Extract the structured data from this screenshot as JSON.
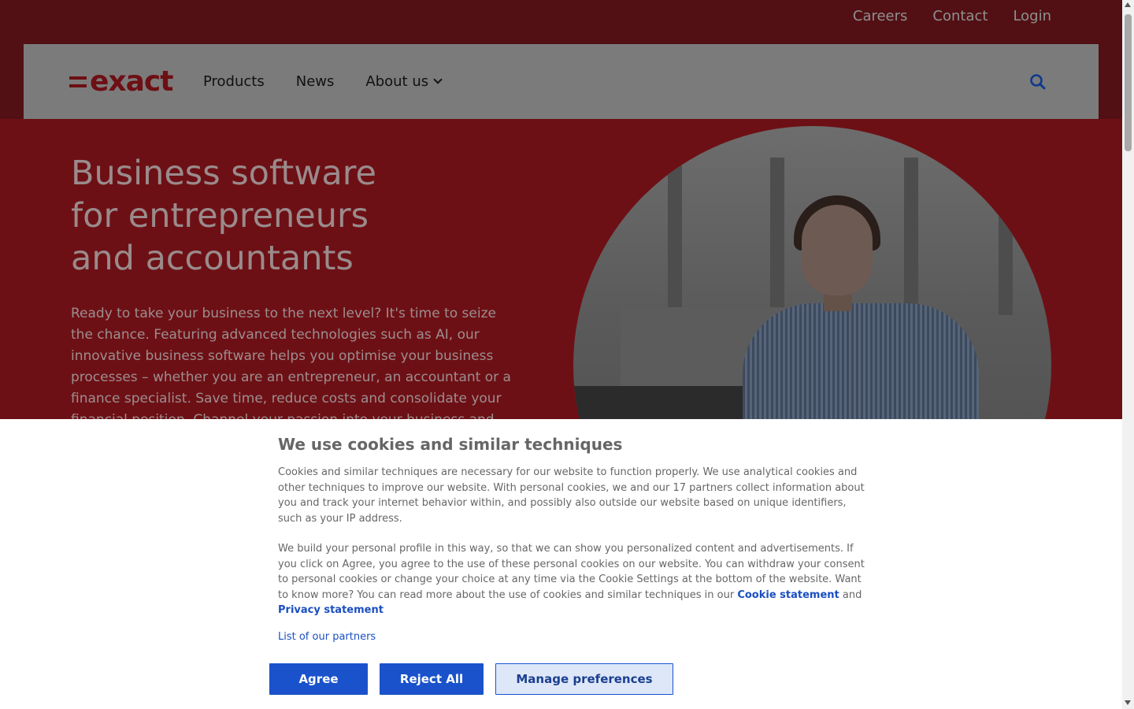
{
  "top_nav": {
    "links": [
      "Careers",
      "Contact",
      "Login"
    ]
  },
  "navbar": {
    "logo_text": "exact",
    "items": {
      "products": "Products",
      "news": "News",
      "about": "About us"
    },
    "search_icon": "search-icon"
  },
  "hero": {
    "title_lines": [
      "Business software",
      "for entrepreneurs",
      "and accountants"
    ],
    "body": "Ready to take your business to the next level? It's time to seize the chance. Featuring advanced technologies such as AI, our innovative business software helps you optimise your business processes – whether you are an entrepreneur, an accountant or a finance specialist. Save time, reduce costs and consolidate your financial position. Channel your passion into your business and"
  },
  "cookie_banner": {
    "title": "We use cookies and similar techniques",
    "paragraph1": "Cookies and similar techniques are necessary for our website to function properly. We use analytical cookies and other techniques to improve our website. With personal cookies, we and our 17 partners collect information about you and track your internet behavior within, and possibly also outside our website based on unique identifiers, such as your IP address.",
    "paragraph2_text": "We build your personal profile in this way, so that we can show you personalized content and advertisements. If you click on Agree, you agree to the use of these personal cookies on our website. You can withdraw your consent to personal cookies or change your choice at any time via the Cookie Settings at the bottom of the website. Want to know more? You can read more about the use of cookies and similar techniques in our ",
    "cookie_statement_link": "Cookie statement",
    "and_text": " and ",
    "privacy_statement_link": "Privacy statement",
    "partners_link": "List of our partners",
    "buttons": {
      "agree": "Agree",
      "reject": "Reject All",
      "manage": "Manage preferences"
    }
  },
  "colors": {
    "hero_bg": "#6d1015",
    "navbar_bg": "#7b7b7b",
    "brand_red": "#6d0f14",
    "button_blue": "#1a52cc",
    "link_blue": "#1a4fc1"
  }
}
